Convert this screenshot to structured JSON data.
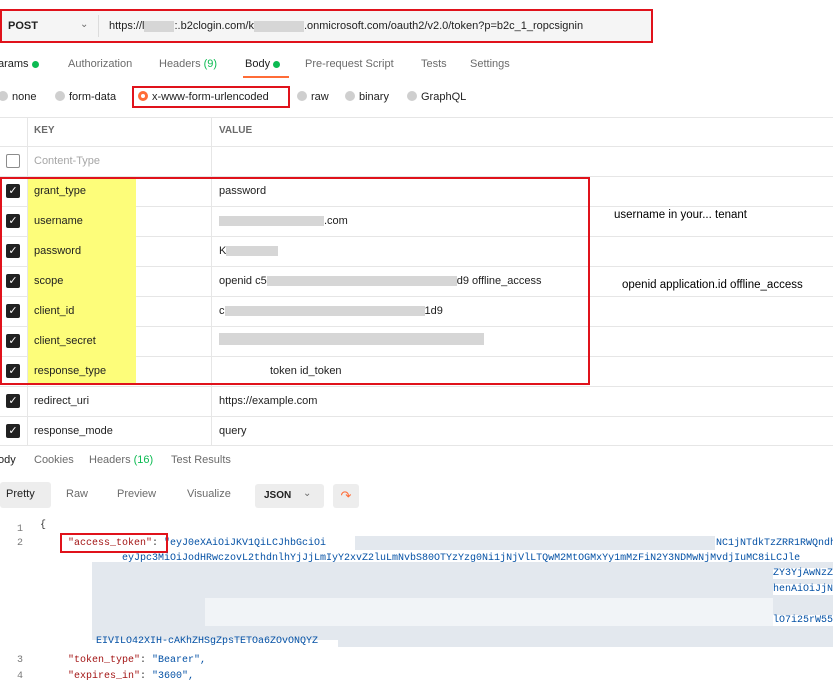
{
  "request": {
    "method": "POST",
    "url_prefix": "https://l",
    "url_part2": ":.b2clogin.com/k",
    "url_part3": ".onmicrosoft.com/oauth2/v2.0/token?p=b2c_1_ropcsignin"
  },
  "tabs": [
    {
      "label": "arams"
    },
    {
      "label": "Authorization"
    },
    {
      "label": "Headers",
      "count": "(9)"
    },
    {
      "label": "Body"
    },
    {
      "label": "Pre-request Script"
    },
    {
      "label": "Tests"
    },
    {
      "label": "Settings"
    }
  ],
  "body_types": [
    "none",
    "form-data",
    "x-www-form-urlencoded",
    "raw",
    "binary",
    "GraphQL"
  ],
  "table": {
    "key_header": "KEY",
    "value_header": "VALUE",
    "placeholder_key": "Content-Type",
    "rows": [
      {
        "key": "grant_type",
        "value": "password"
      },
      {
        "key": "username",
        "value": ".com",
        "value_suffix": ".com"
      },
      {
        "key": "password",
        "value": "K"
      },
      {
        "key": "scope",
        "value_prefix": "openid  c5",
        "value_suffix": "d9 offline_access"
      },
      {
        "key": "client_id",
        "value_prefix": "c",
        "value_suffix": "1d9"
      },
      {
        "key": "client_secret",
        "value": ""
      },
      {
        "key": "response_type",
        "value": "token id_token"
      },
      {
        "key": "redirect_uri",
        "value": "https://example.com"
      },
      {
        "key": "response_mode",
        "value": "query"
      }
    ]
  },
  "notes": {
    "username": "username  in  your...     tenant",
    "scope": "openid application.id offline_access"
  },
  "response": {
    "tabs": [
      "ody",
      "Cookies",
      "Headers",
      "Test Results"
    ],
    "headers_count": "(16)",
    "views": [
      "Pretty",
      "Raw",
      "Preview",
      "Visualize"
    ],
    "format": "JSON",
    "lines": [
      {
        "n": "1",
        "text": "{"
      },
      {
        "n": "2",
        "key": "\"access_token\"",
        "value_start": "\"eyJ0eXAiOiJKV1QiLCJhbGciOi",
        "value_end": "NC1jNTdkTzZRR1RWQndh"
      },
      {
        "cont1": "eyJpc3MiOiJodHRwczovL2thdnlhYjJjLmIyY2xvZ2luLmNvbS80OTYzYzg0Ni1jNjVlLTQwM2MtOGMxYy1mMzFiN2Y3NDMwNjMvdjIuMC8iLCJle"
      },
      {
        "cont2": "ZY3YjAwNzZ"
      },
      {
        "cont3": "henAiOiJjN"
      },
      {
        "cont4": "lO7i25rW55"
      },
      {
        "cont5": "EIVILO42XIH-cAKhZHSgZpsTETOa6ZOvONQYZ"
      },
      {
        "n": "3",
        "key": "\"token_type\"",
        "value": "\"Bearer\","
      },
      {
        "n": "4",
        "key": "\"expires_in\"",
        "value": "\"3600\","
      }
    ]
  }
}
